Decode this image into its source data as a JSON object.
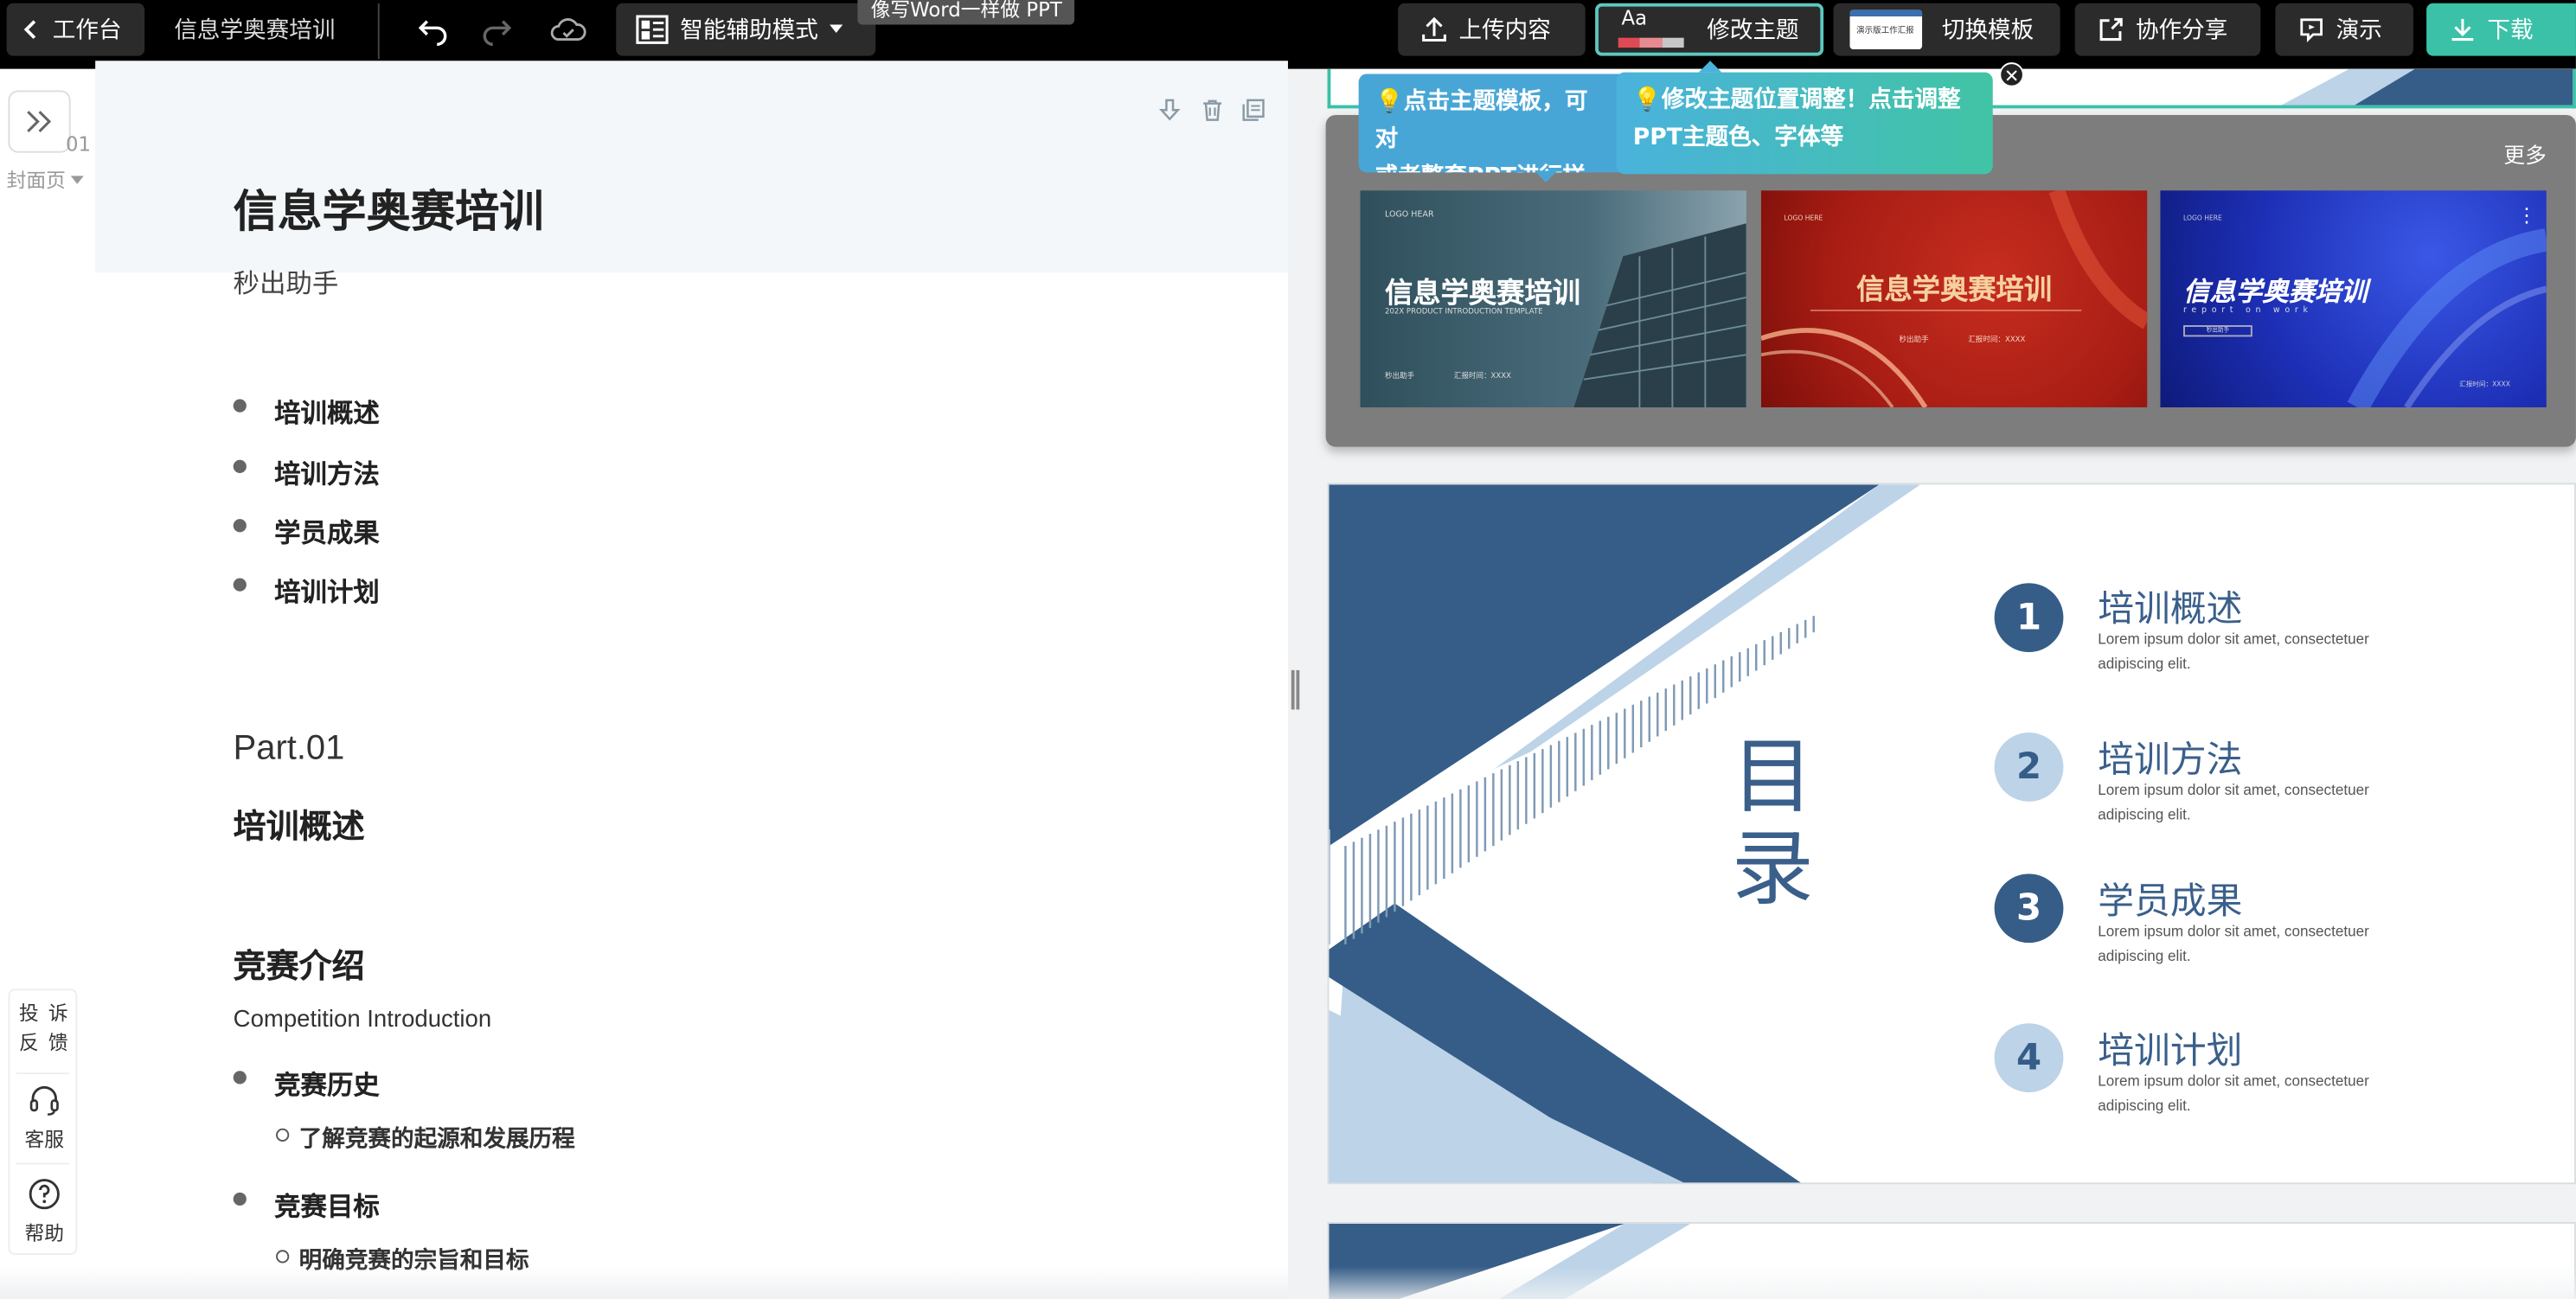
{
  "topbar": {
    "back_label": "工作台",
    "doc_title": "信息学奥赛培训",
    "mode_label": "智能辅助模式",
    "mode_tooltip": "像写Word一样做 PPT",
    "upload_label": "上传内容",
    "theme_icon_text": "Aa",
    "theme_label": "修改主题",
    "switch_template_label": "切换模板",
    "template_thumb_text": "演示版工作汇报",
    "share_label": "协作分享",
    "present_label": "演示",
    "download_label": "下载"
  },
  "editor": {
    "page_number": "01",
    "page_type": "封面页",
    "title": "信息学奥赛培训",
    "subtitle": "秒出助手",
    "outline": [
      "培训概述",
      "培训方法",
      "学员成果",
      "培训计划"
    ],
    "part_label": "Part.01",
    "part_title": "培训概述",
    "section_title": "竞赛介绍",
    "section_subtitle": "Competition Introduction",
    "items": [
      {
        "label": "竞赛历史",
        "sub": "了解竞赛的起源和发展历程"
      },
      {
        "label": "竞赛目标",
        "sub": "明确竞赛的宗旨和目标"
      }
    ]
  },
  "side_tools": {
    "feedback_label": "投 诉\n反 馈",
    "service_label": "客服",
    "help_label": "帮助"
  },
  "theme_panel": {
    "more_label": "更多",
    "tip1": "💡点击主题模板，可对\n或者整套PPT进行样式",
    "tip2": "💡修改主题位置调整！点击调整\nPPT主题色、字体等",
    "thumbs": [
      {
        "logo": "LOGO HEAR",
        "title": "信息学奥赛培训",
        "sub": "202X PRODUCT INTRODUCTION TEMPLATE",
        "meta1": "秒出助手",
        "meta2": "汇报时间：XXXX"
      },
      {
        "logo": "LOGO HERE",
        "title": "信息学奥赛培训",
        "meta1": "秒出助手",
        "meta2": "汇报时间：XXXX"
      },
      {
        "logo": "LOGO HERE",
        "title": "信息学奥赛培训",
        "sub": "report on work",
        "meta1": "秒出助手",
        "meta2": "汇报时间：XXXX"
      }
    ]
  },
  "toc_slide": {
    "heading": "目录",
    "items": [
      {
        "num": "1",
        "title": "培训概述",
        "desc": "Lorem ipsum dolor sit amet, consectetuer adipiscing elit."
      },
      {
        "num": "2",
        "title": "培训方法",
        "desc": "Lorem ipsum dolor sit amet, consectetuer adipiscing elit."
      },
      {
        "num": "3",
        "title": "学员成果",
        "desc": "Lorem ipsum dolor sit amet, consectetuer adipiscing elit."
      },
      {
        "num": "4",
        "title": "培训计划",
        "desc": "Lorem ipsum dolor sit amet, consectetuer adipiscing elit."
      }
    ]
  },
  "colors": {
    "accent_teal": "#3bc1a8",
    "navy": "#355d87",
    "light_blue": "#bcd3e8",
    "tip_blue": "#48a6d6",
    "tip_green": "#41c4a4"
  }
}
